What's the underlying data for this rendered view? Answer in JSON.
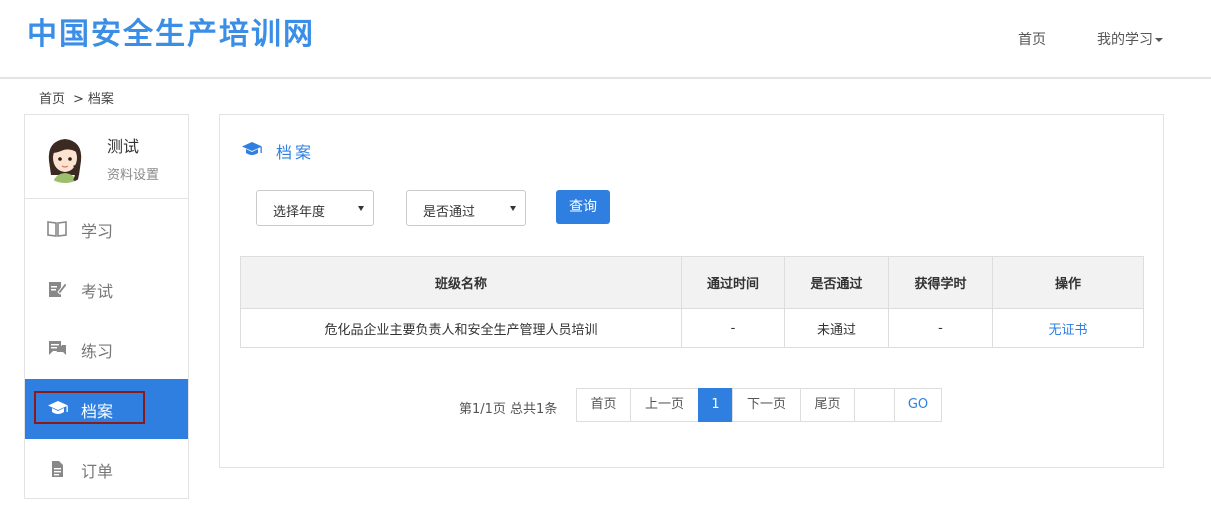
{
  "header": {
    "logo": "中国安全生产培训网",
    "nav": {
      "home": "首页",
      "my_learning": "我的学习"
    }
  },
  "breadcrumb": {
    "home": "首页",
    "separator": ">",
    "current": "档案"
  },
  "sidebar": {
    "username": "测试",
    "settings": "资料设置",
    "items": [
      {
        "label": "学习",
        "icon": "book-icon"
      },
      {
        "label": "考试",
        "icon": "edit-icon"
      },
      {
        "label": "练习",
        "icon": "chat-icon"
      },
      {
        "label": "档案",
        "icon": "graduation-cap-icon",
        "active": true
      },
      {
        "label": "订单",
        "icon": "document-icon"
      }
    ]
  },
  "main": {
    "title": "档案",
    "filters": {
      "year": {
        "selected": "选择年度"
      },
      "passed": {
        "selected": "是否通过"
      },
      "query_label": "查询"
    },
    "table": {
      "headers": [
        "班级名称",
        "通过时间",
        "是否通过",
        "获得学时",
        "操作"
      ],
      "rows": [
        [
          "危化品企业主要负责人和安全生产管理人员培训",
          "-",
          "未通过",
          "-",
          "无证书"
        ]
      ]
    },
    "pagination": {
      "info": "第1/1页 总共1条",
      "first": "首页",
      "prev": "上一页",
      "current": "1",
      "next": "下一页",
      "last": "尾页",
      "go": "GO"
    }
  },
  "colors": {
    "accent": "#2f7fe0",
    "logo": "#3a8ee6",
    "highlight_outline": "#8b1a1a"
  }
}
